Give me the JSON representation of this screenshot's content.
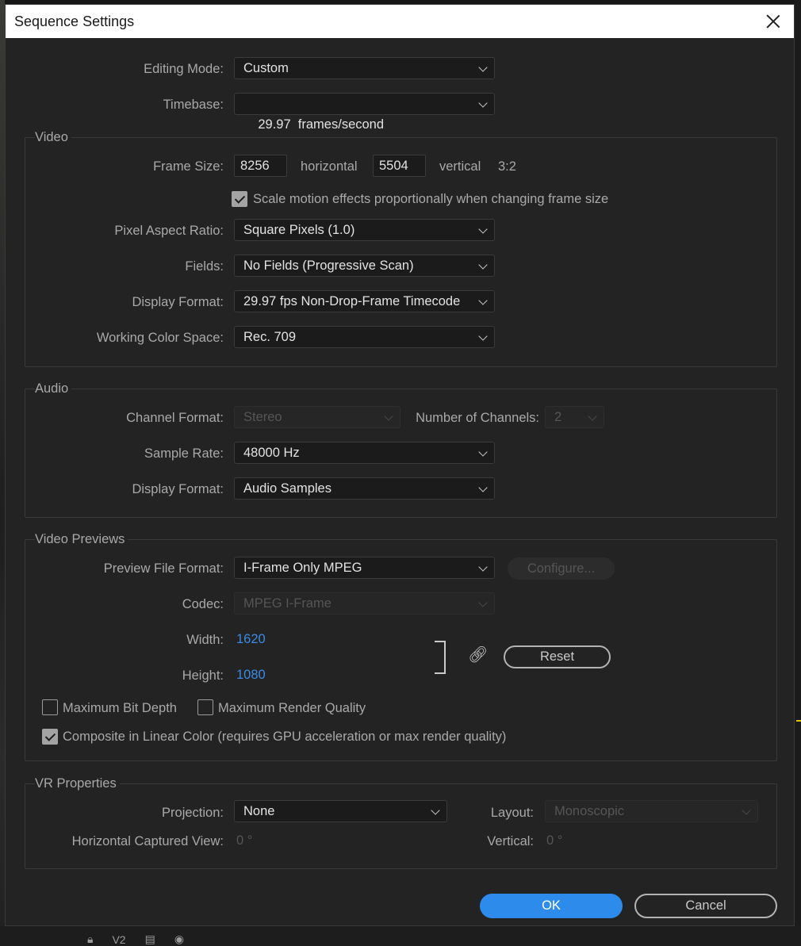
{
  "dialog": {
    "title": "Sequence Settings"
  },
  "general": {
    "editing_mode_label": "Editing Mode:",
    "editing_mode_value": "Custom",
    "timebase_label": "Timebase:",
    "timebase_value": "29.97  frames/second"
  },
  "video": {
    "section_title": "Video",
    "frame_size_label": "Frame Size:",
    "frame_width": "8256",
    "horizontal_label": "horizontal",
    "frame_height": "5504",
    "vertical_label": "vertical",
    "aspect": "3:2",
    "scale_motion_label": "Scale motion effects proportionally when changing frame size",
    "scale_motion_checked": true,
    "pixel_aspect_label": "Pixel Aspect Ratio:",
    "pixel_aspect_value": "Square Pixels (1.0)",
    "fields_label": "Fields:",
    "fields_value": "No Fields (Progressive Scan)",
    "display_format_label": "Display Format:",
    "display_format_value": "29.97 fps Non-Drop-Frame Timecode",
    "color_space_label": "Working Color Space:",
    "color_space_value": "Rec. 709"
  },
  "audio": {
    "section_title": "Audio",
    "channel_format_label": "Channel Format:",
    "channel_format_value": "Stereo",
    "num_channels_label": "Number of Channels:",
    "num_channels_value": "2",
    "sample_rate_label": "Sample Rate:",
    "sample_rate_value": "48000 Hz",
    "display_format_label": "Display Format:",
    "display_format_value": "Audio Samples"
  },
  "previews": {
    "section_title": "Video Previews",
    "preview_format_label": "Preview File Format:",
    "preview_format_value": "I-Frame Only MPEG",
    "configure_label": "Configure...",
    "codec_label": "Codec:",
    "codec_value": "MPEG I-Frame",
    "width_label": "Width:",
    "width_value": "1620",
    "height_label": "Height:",
    "height_value": "1080",
    "reset_label": "Reset",
    "max_bit_depth_label": "Maximum Bit Depth",
    "max_bit_depth_checked": false,
    "max_render_quality_label": "Maximum Render Quality",
    "max_render_quality_checked": false,
    "linear_color_label": "Composite in Linear Color (requires GPU acceleration or max render quality)",
    "linear_color_checked": true
  },
  "vr": {
    "section_title": "VR Properties",
    "projection_label": "Projection:",
    "projection_value": "None",
    "layout_label": "Layout:",
    "layout_value": "Monoscopic",
    "hcv_label": "Horizontal Captured View:",
    "hcv_value": "0 °",
    "vertical_label": "Vertical:",
    "vertical_value": "0 °"
  },
  "footer": {
    "ok_label": "OK",
    "cancel_label": "Cancel"
  },
  "background": {
    "track_label": "V2"
  },
  "icons": {
    "link": "link-icon",
    "lock": "lock-icon",
    "film": "film-icon",
    "eye": "eye-icon",
    "close": "close-icon",
    "chevron": "chevron-down-icon"
  }
}
